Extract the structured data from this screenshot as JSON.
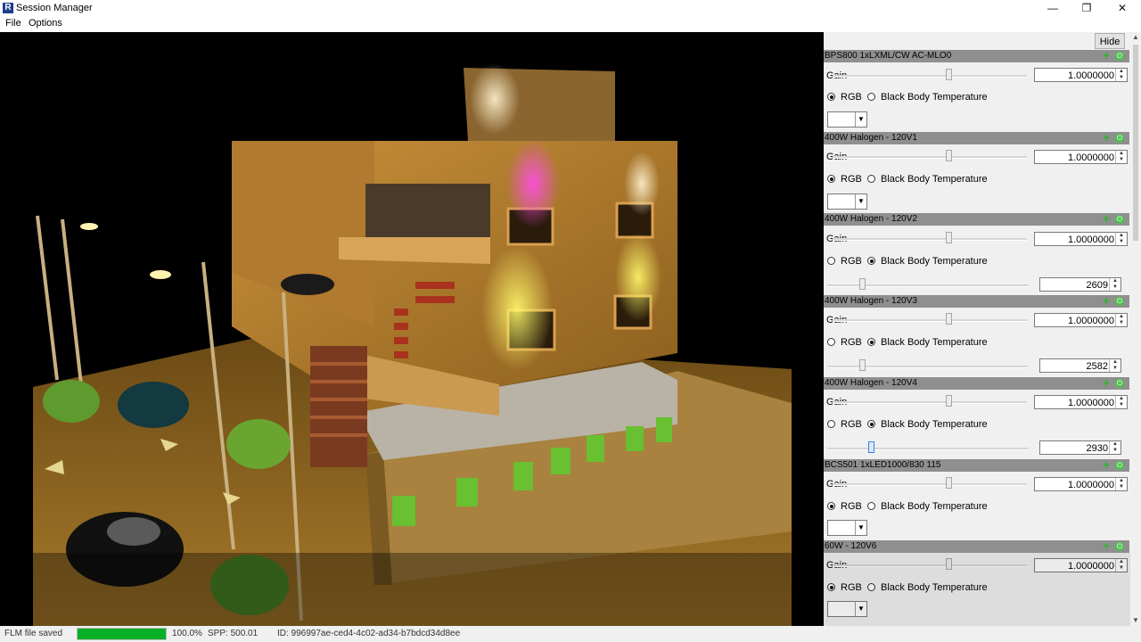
{
  "window": {
    "icon_letter": "R",
    "title": "Session Manager",
    "minimize_glyph": "—",
    "restore_glyph": "❐",
    "close_glyph": "✕"
  },
  "menu": {
    "items": [
      "File",
      "Options"
    ]
  },
  "panel": {
    "hide_label": "Hide",
    "gain_label": "Gain",
    "rgb_label": "RGB",
    "bbt_label": "Black Body Temperature",
    "lights": [
      {
        "name": "BPS800 1xLXML/CW AC-MLO0",
        "gain": "1.0000000",
        "mode": "RGB",
        "temperature": ""
      },
      {
        "name": "400W Halogen - 120V1",
        "gain": "1.0000000",
        "mode": "RGB",
        "temperature": ""
      },
      {
        "name": "400W Halogen - 120V2",
        "gain": "1.0000000",
        "mode": "BBT",
        "temperature": "2609"
      },
      {
        "name": "400W Halogen - 120V3",
        "gain": "1.0000000",
        "mode": "BBT",
        "temperature": "2582"
      },
      {
        "name": "400W Halogen - 120V4",
        "gain": "1.0000000",
        "mode": "BBT",
        "temperature": "2930"
      },
      {
        "name": "BCS501 1xLED1000/830 115",
        "gain": "1.0000000",
        "mode": "RGB",
        "temperature": ""
      },
      {
        "name": "60W - 120V6",
        "gain": "1.0000000",
        "mode": "RGB",
        "temperature": ""
      }
    ]
  },
  "status": {
    "message": "FLM file saved",
    "progress_label": "100.0%",
    "progress_value": 1.0,
    "spp": "SPP:  500.01",
    "id": "ID:  996997ae-ced4-4c02-ad34-b7bdcd34d8ee"
  },
  "colors": {
    "header_bg": "#8f8f8f",
    "progress": "#06b025",
    "panel_bg": "#f0f0f0"
  },
  "icons": {
    "add": "plus-icon",
    "power": "power-icon"
  }
}
